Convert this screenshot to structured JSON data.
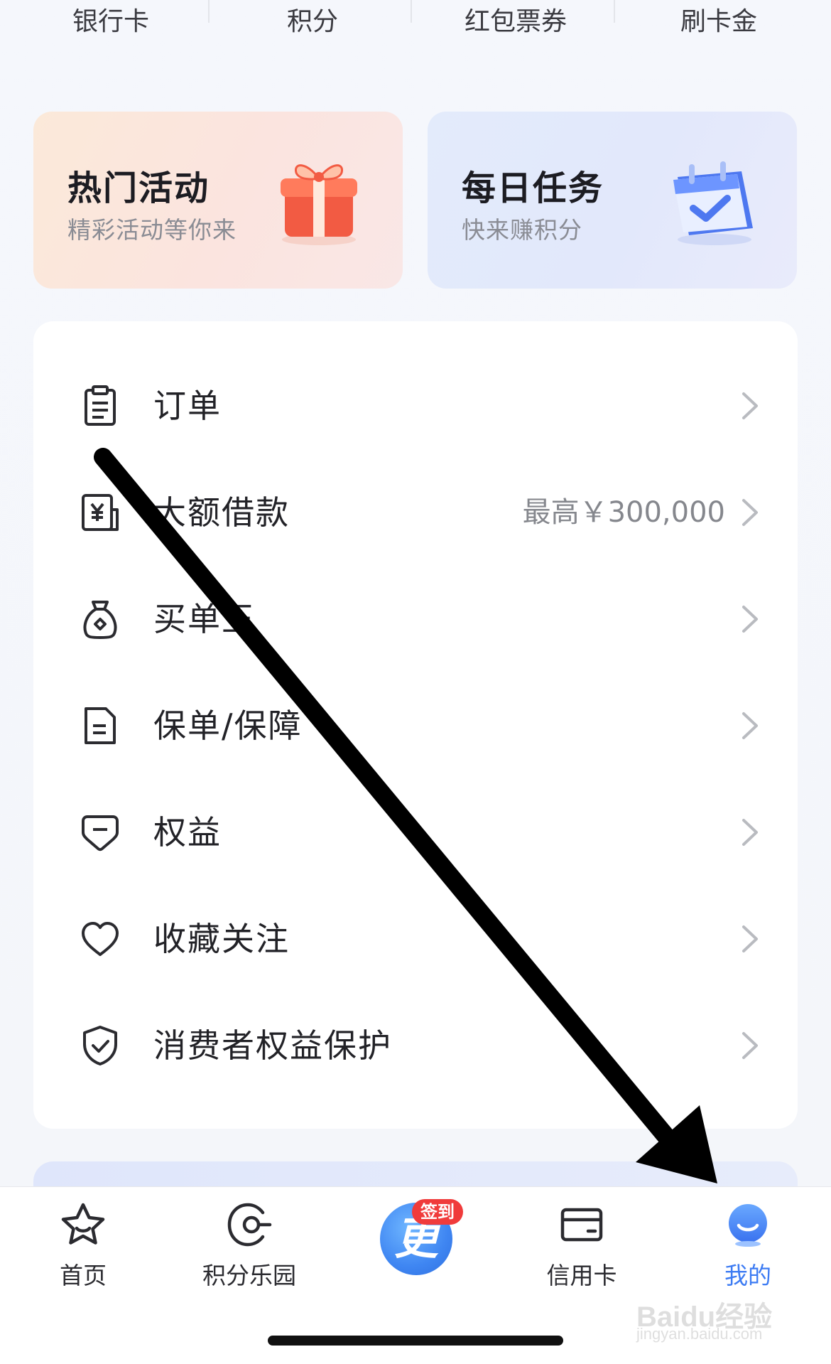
{
  "top_shortcuts": [
    "银行卡",
    "积分",
    "红包票券",
    "刷卡金"
  ],
  "promos": [
    {
      "title": "热门活动",
      "subtitle": "精彩活动等你来",
      "icon": "gift-icon"
    },
    {
      "title": "每日任务",
      "subtitle": "快来赚积分",
      "icon": "calendar-check-icon"
    }
  ],
  "menu": [
    {
      "label": "订单",
      "value": "",
      "icon": "clipboard-icon"
    },
    {
      "label": "大额借款",
      "value": "最高￥300,000",
      "icon": "loan-icon"
    },
    {
      "label": "买单王",
      "value": "",
      "icon": "money-bag-icon"
    },
    {
      "label": "保单/保障",
      "value": "",
      "icon": "policy-document-icon"
    },
    {
      "label": "权益",
      "value": "",
      "icon": "rights-tag-icon"
    },
    {
      "label": "收藏关注",
      "value": "",
      "icon": "heart-icon"
    },
    {
      "label": "消费者权益保护",
      "value": "",
      "icon": "shield-check-icon"
    }
  ],
  "tabbar": {
    "tabs": [
      {
        "label": "首页",
        "icon": "star-icon"
      },
      {
        "label": "积分乐园",
        "icon": "points-park-icon"
      },
      {
        "label": "信用卡",
        "icon": "credit-card-icon"
      },
      {
        "label": "我的",
        "icon": "profile-icon"
      }
    ],
    "center_glyph": "更",
    "center_badge": "签到",
    "active_tab": "我的"
  },
  "watermark": {
    "line1": "Baidu经验",
    "line2": "jingyan.baidu.com"
  },
  "colors": {
    "accent": "#3c7bf3",
    "badge": "#f03b3b",
    "text": "#1f1f24",
    "muted": "#85878d"
  }
}
